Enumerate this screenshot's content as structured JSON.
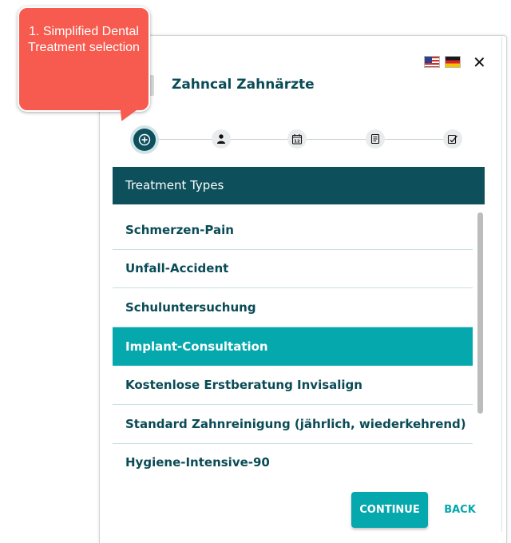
{
  "callout": {
    "text": "1. Simplified Dental Treatment selection"
  },
  "header": {
    "title": "Zahncal Zahnärzte",
    "languages": [
      {
        "code": "en",
        "icon": "us-flag-icon"
      },
      {
        "code": "de",
        "icon": "german-flag-icon"
      }
    ],
    "close_icon": "close-icon"
  },
  "stepper": {
    "steps": [
      {
        "icon": "plus-circle-icon",
        "active": true
      },
      {
        "icon": "person-icon",
        "active": false
      },
      {
        "icon": "calendar-icon",
        "active": false
      },
      {
        "icon": "document-icon",
        "active": false
      },
      {
        "icon": "signature-icon",
        "active": false
      }
    ],
    "calendar_day": "12"
  },
  "list": {
    "header": "Treatment Types",
    "items": [
      {
        "label": "Schmerzen-Pain",
        "selected": false
      },
      {
        "label": "Unfall-Accident",
        "selected": false
      },
      {
        "label": "Schuluntersuchung",
        "selected": false
      },
      {
        "label": "Implant-Consultation",
        "selected": true
      },
      {
        "label": "Kostenlose Erstberatung Invisalign",
        "selected": false
      },
      {
        "label": "Standard Zahnreinigung (jährlich, wiederkehrend)",
        "selected": false
      },
      {
        "label": "Hygiene-Intensive-90",
        "selected": false
      }
    ]
  },
  "buttons": {
    "continue": "CONTINUE",
    "back": "BACK"
  },
  "colors": {
    "primary_dark": "#0d4f5a",
    "accent": "#04a8ad",
    "callout": "#f75a4e"
  }
}
